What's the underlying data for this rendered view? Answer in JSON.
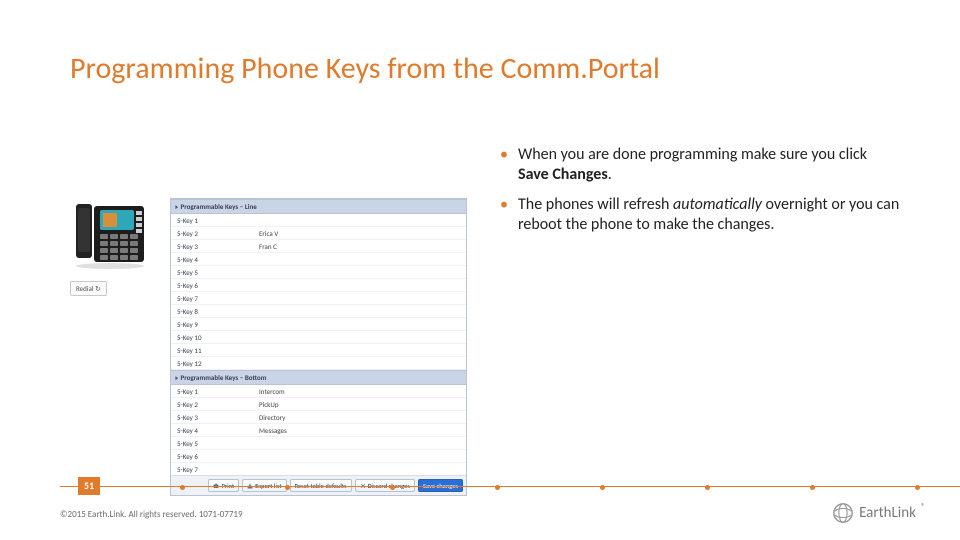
{
  "title": "Programming Phone Keys from the Comm.Portal",
  "bullets": [
    {
      "pre": "When you are done programming make sure you click ",
      "bold": "Save Changes",
      "post": "."
    },
    {
      "pre": "The phones will refresh ",
      "ital": "automatically",
      "post": " overnight or you can reboot the phone to make the changes."
    }
  ],
  "redial_label": "Redial ↻",
  "panel": {
    "sections": [
      {
        "header_prefix": "▸Programmable Keys – ",
        "header_suffix": "Line",
        "rows": [
          {
            "k": "5-Key 1",
            "v": ""
          },
          {
            "k": "5-Key 2",
            "v": "Erica V"
          },
          {
            "k": "5-Key 3",
            "v": "Fran C"
          },
          {
            "k": "5-Key 4",
            "v": ""
          },
          {
            "k": "5-Key 5",
            "v": ""
          },
          {
            "k": "5-Key 6",
            "v": ""
          },
          {
            "k": "5-Key 7",
            "v": ""
          },
          {
            "k": "5-Key 8",
            "v": ""
          },
          {
            "k": "5-Key 9",
            "v": ""
          },
          {
            "k": "5-Key 10",
            "v": ""
          },
          {
            "k": "5-Key 11",
            "v": ""
          },
          {
            "k": "5-Key 12",
            "v": ""
          }
        ]
      },
      {
        "header_prefix": "▸Programmable Keys – ",
        "header_suffix": "Bottom",
        "rows": [
          {
            "k": "5-Key 1",
            "v": "Intercom"
          },
          {
            "k": "5-Key 2",
            "v": "PickUp"
          },
          {
            "k": "5-Key 3",
            "v": "Directory"
          },
          {
            "k": "5-Key 4",
            "v": "Messages"
          },
          {
            "k": "5-Key 5",
            "v": ""
          },
          {
            "k": "5-Key 6",
            "v": ""
          },
          {
            "k": "5-Key 7",
            "v": ""
          }
        ]
      }
    ],
    "buttons": {
      "print": "Print",
      "export": "Export list",
      "reset": "Reset table defaults",
      "discard": "Discard changes",
      "save": "Save changes"
    }
  },
  "page_number": "51",
  "copyright": "©2015 Earth.Link. All rights reserved. 1071-07719",
  "logo_text": "EarthLink"
}
